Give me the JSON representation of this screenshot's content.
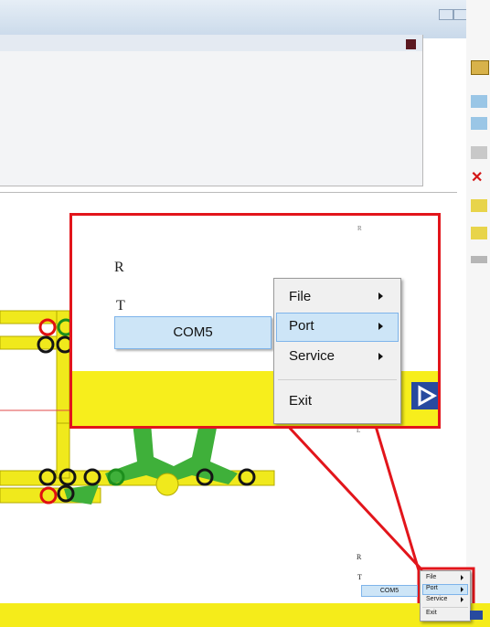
{
  "zoom": {
    "letter_r": "R",
    "letter_t": "T",
    "submenu_item": "COM5",
    "menu_items": [
      {
        "label": "File",
        "has_submenu": true
      },
      {
        "label": "Port",
        "has_submenu": true,
        "highlighted": true
      },
      {
        "label": "Service",
        "has_submenu": true
      },
      {
        "label": "Exit",
        "has_submenu": false
      }
    ]
  },
  "small": {
    "letter_r": "R",
    "letter_t": "T",
    "submenu_item": "COM5",
    "menu_items": [
      {
        "label": "File",
        "has_submenu": true
      },
      {
        "label": "Port",
        "has_submenu": true,
        "highlighted": true
      },
      {
        "label": "Service",
        "has_submenu": true
      },
      {
        "label": "Exit",
        "has_submenu": false
      }
    ]
  },
  "colors": {
    "callout": "#e2151b",
    "track": "#f0e91c",
    "track_green": "#3fb03a",
    "highlight": "#cde5f7"
  },
  "icons": [
    "minimize-icon",
    "maximize-icon",
    "close-icon",
    "play-button-icon",
    "tool-icons"
  ]
}
